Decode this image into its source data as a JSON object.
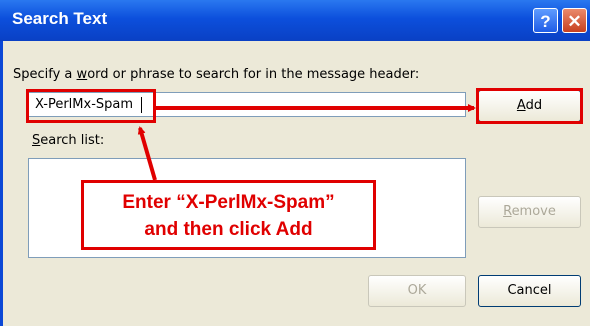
{
  "window": {
    "title": "Search Text",
    "help_glyph": "?",
    "close_glyph": "✕"
  },
  "form": {
    "instruction_pre": "Specify a ",
    "instruction_accel": "w",
    "instruction_post": "ord or phrase to search for in the message header:",
    "input_value": "X-PerlMx-Spam",
    "list_label_accel": "S",
    "list_label_rest": "earch list:",
    "list_items": []
  },
  "buttons": {
    "add_accel": "A",
    "add_rest": "dd",
    "remove_accel": "R",
    "remove_rest": "emove",
    "ok": "OK",
    "cancel": "Cancel"
  },
  "annotation": {
    "line1": "Enter “X-PerlMx-Spam”",
    "line2": "and then click  Add",
    "color": "#e00000"
  },
  "colors": {
    "titlebar": "#0c48d6",
    "dialog_face": "#ece9d8",
    "field_border": "#7f9db9"
  },
  "icons": {
    "help": "help-icon",
    "close": "close-icon"
  }
}
